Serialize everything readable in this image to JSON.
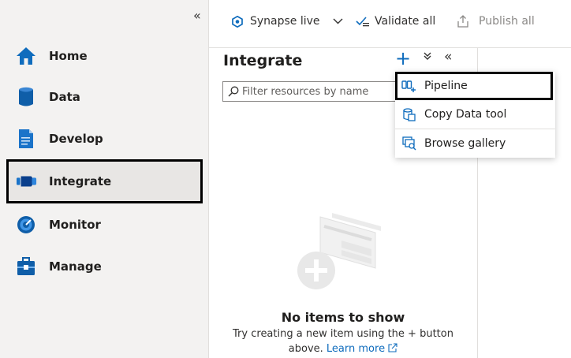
{
  "sidebar": {
    "collapse_glyph": "«",
    "items": [
      {
        "label": "Home",
        "icon": "home-icon"
      },
      {
        "label": "Data",
        "icon": "data-icon"
      },
      {
        "label": "Develop",
        "icon": "develop-icon"
      },
      {
        "label": "Integrate",
        "icon": "integrate-icon",
        "active": true
      },
      {
        "label": "Monitor",
        "icon": "monitor-icon"
      },
      {
        "label": "Manage",
        "icon": "manage-icon"
      }
    ]
  },
  "toolbar": {
    "workspace_label": "Synapse live",
    "validate_label": "Validate all",
    "publish_label": "Publish all"
  },
  "panel": {
    "title": "Integrate",
    "add_glyph": "+",
    "expand_glyph": "»",
    "collapse_glyph": "«",
    "filter_placeholder": "Filter resources by name",
    "empty": {
      "title": "No items to show",
      "line1": "Try creating a new item using the + button",
      "line2_prefix": "above.",
      "link": "Learn more"
    }
  },
  "add_menu": {
    "items": [
      {
        "label": "Pipeline",
        "icon": "pipeline-icon",
        "highlighted": true
      },
      {
        "label": "Copy Data tool",
        "icon": "copy-data-icon"
      },
      {
        "label": "Browse gallery",
        "icon": "gallery-icon"
      }
    ]
  },
  "colors": {
    "accent": "#0f6cbd",
    "sidebar_bg": "#f3f2f1",
    "highlight_border": "#000000"
  }
}
